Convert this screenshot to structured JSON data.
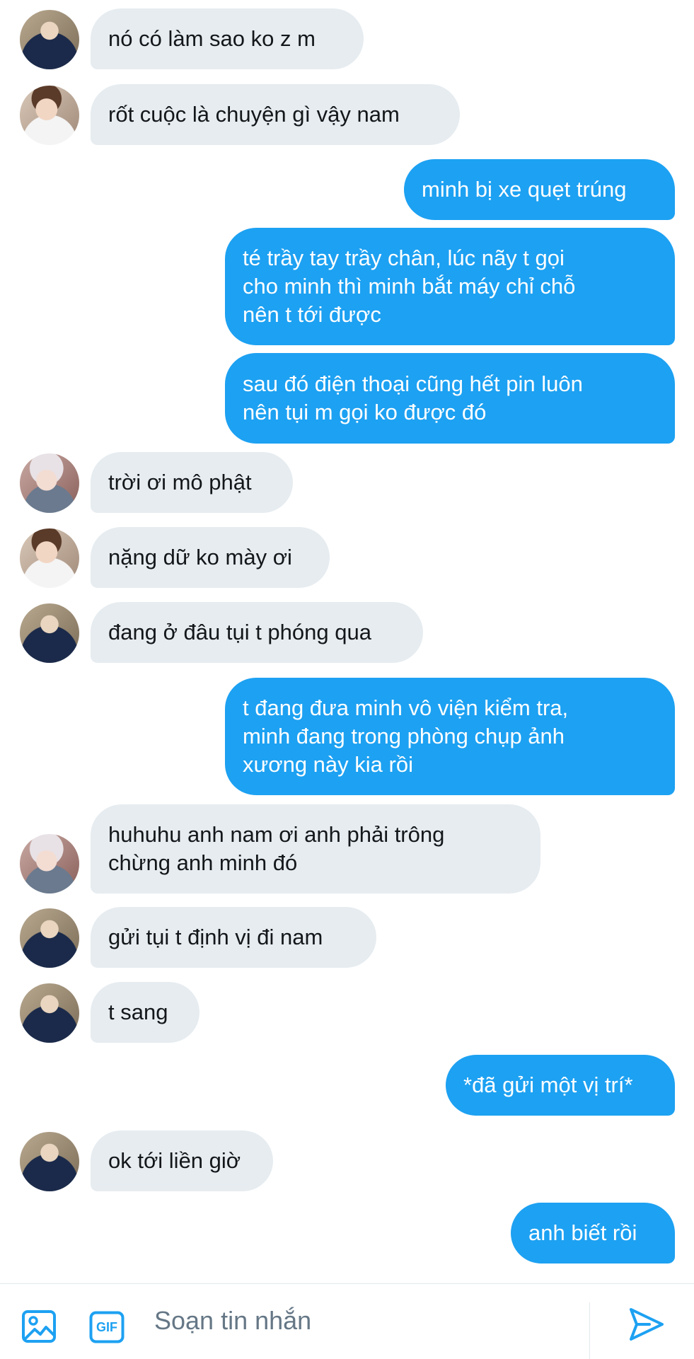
{
  "messages": [
    {
      "from": "left",
      "avatar": "person-a",
      "text": "nó có làm sao ko z m"
    },
    {
      "from": "left",
      "avatar": "person-b",
      "text": "rốt cuộc là chuyện gì vậy nam"
    },
    {
      "from": "right",
      "text": "minh bị xe quẹt trúng"
    },
    {
      "from": "right",
      "text": "té trầy tay trầy chân, lúc nãy t gọi\ncho minh thì minh bắt máy chỉ chỗ\nnên t tới được"
    },
    {
      "from": "right",
      "text": "sau đó điện thoại cũng hết pin luôn\nnên tụi m gọi ko được đó"
    },
    {
      "from": "left",
      "avatar": "person-c",
      "text": "trời ơi mô phật"
    },
    {
      "from": "left",
      "avatar": "person-b",
      "text": "nặng dữ ko mày ơi"
    },
    {
      "from": "left",
      "avatar": "person-a",
      "text": "đang ở đâu tụi t phóng qua"
    },
    {
      "from": "right",
      "text": "t đang đưa minh vô viện kiểm tra,\nminh đang trong phòng chụp ảnh\nxương này kia rồi"
    },
    {
      "from": "left",
      "avatar": "person-c",
      "text": "huhuhu anh nam ơi anh phải trông\nchừng anh minh đó"
    },
    {
      "from": "left",
      "avatar": "person-a",
      "text": "gửi tụi t định vị đi nam"
    },
    {
      "from": "left",
      "avatar": "person-a",
      "text": "t sang"
    },
    {
      "from": "right",
      "text": "*đã gửi một vị trí*"
    },
    {
      "from": "left",
      "avatar": "person-a",
      "text": "ok tới liền giờ"
    },
    {
      "from": "right",
      "text": "anh biết rồi"
    }
  ],
  "composer": {
    "placeholder": "Soạn tin nhắn",
    "gif_label": "GIF",
    "image_icon": "image-icon",
    "send_icon": "send-icon"
  },
  "colors": {
    "outgoing": "#1da1f2",
    "incoming": "#e6ecf0",
    "accent": "#1da1f2",
    "placeholder": "#657786"
  }
}
